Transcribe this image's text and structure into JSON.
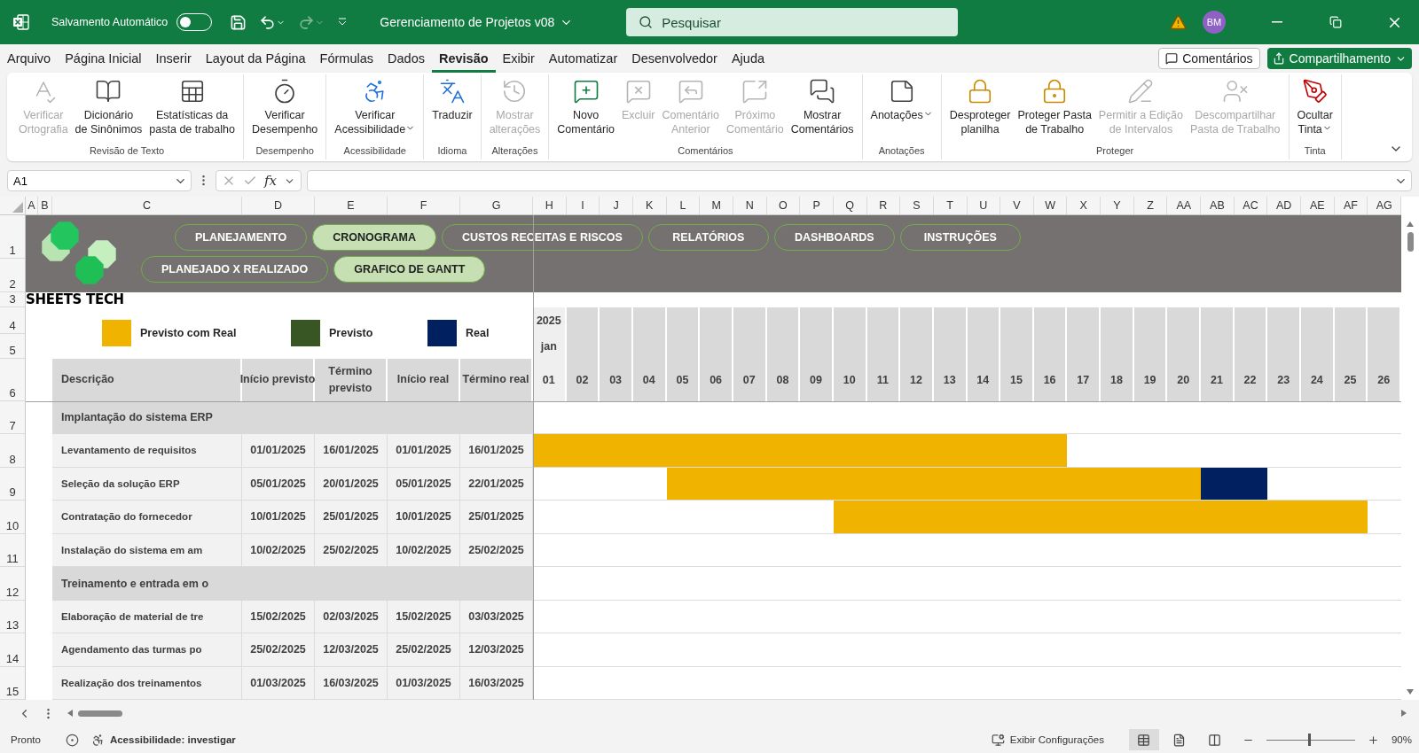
{
  "title_bar": {
    "autosave_label": "Salvamento Automático",
    "autosave_on": false,
    "redo_disabled": true,
    "title": "Gerenciamento de Projetos v08",
    "search": {
      "placeholder": "Pesquisar"
    },
    "avatar": "BM"
  },
  "menu": {
    "tabs": [
      {
        "label": "Arquivo",
        "selected": false
      },
      {
        "label": "Página Inicial",
        "selected": false
      },
      {
        "label": "Inserir",
        "selected": false
      },
      {
        "label": "Layout da Página",
        "selected": false
      },
      {
        "label": "Fórmulas",
        "selected": false
      },
      {
        "label": "Dados",
        "selected": false
      },
      {
        "label": "Revisão",
        "selected": true
      },
      {
        "label": "Exibir",
        "selected": false
      },
      {
        "label": "Automatizar",
        "selected": false
      },
      {
        "label": "Desenvolvedor",
        "selected": false
      },
      {
        "label": "Ajuda",
        "selected": false
      }
    ],
    "comments_button": "Comentários",
    "share_button": "Compartilhamento"
  },
  "ribbon": {
    "groups": [
      {
        "label": "Revisão de Texto",
        "buttons": [
          {
            "label": "Verificar\nOrtografia",
            "disabled": true,
            "dropdown": false
          },
          {
            "label": "Dicionário\nde Sinônimos",
            "disabled": false,
            "dropdown": false
          },
          {
            "label": "Estatísticas da\npasta de trabalho",
            "disabled": false,
            "dropdown": false
          }
        ]
      },
      {
        "label": "Desempenho",
        "buttons": [
          {
            "label": "Verificar\nDesempenho",
            "disabled": false,
            "dropdown": false
          }
        ]
      },
      {
        "label": "Acessibilidade",
        "buttons": [
          {
            "label": "Verificar\nAcessibilidade",
            "disabled": false,
            "dropdown": true
          }
        ]
      },
      {
        "label": "Idioma",
        "buttons": [
          {
            "label": "Traduzir",
            "disabled": false,
            "dropdown": false
          }
        ]
      },
      {
        "label": "Alterações",
        "buttons": [
          {
            "label": "Mostrar\nalterações",
            "disabled": true,
            "dropdown": false
          }
        ]
      },
      {
        "label": "Comentários",
        "buttons": [
          {
            "label": "Novo\nComentário",
            "disabled": false,
            "dropdown": false
          },
          {
            "label": "Excluir",
            "disabled": true,
            "dropdown": false
          },
          {
            "label": "Comentário\nAnterior",
            "disabled": true,
            "dropdown": false
          },
          {
            "label": "Próximo\nComentário",
            "disabled": true,
            "dropdown": false
          },
          {
            "label": "Mostrar\nComentários",
            "disabled": false,
            "dropdown": false
          }
        ]
      },
      {
        "label": "Anotações",
        "buttons": [
          {
            "label": "Anotações",
            "disabled": false,
            "dropdown": true
          }
        ]
      },
      {
        "label": "Proteger",
        "buttons": [
          {
            "label": "Desproteger\nplanilha",
            "disabled": false,
            "dropdown": false
          },
          {
            "label": "Proteger Pasta\nde Trabalho",
            "disabled": false,
            "dropdown": false
          },
          {
            "label": "Permitir a Edição\nde Intervalos",
            "disabled": true,
            "dropdown": false
          },
          {
            "label": "Descompartilhar\nPasta de Trabalho",
            "disabled": true,
            "dropdown": false
          }
        ]
      },
      {
        "label": "Tinta",
        "buttons": [
          {
            "label": "Ocultar\nTinta",
            "disabled": false,
            "dropdown": true
          }
        ]
      }
    ]
  },
  "formula_bar": {
    "name_box": "A1",
    "function_label": "fx"
  },
  "sheet": {
    "columns": [
      "A",
      "B",
      "C",
      "D",
      "E",
      "F",
      "G",
      "H",
      "I",
      "J",
      "K",
      "L",
      "M",
      "N",
      "O",
      "P",
      "Q",
      "R",
      "S",
      "T",
      "U",
      "V",
      "W",
      "X",
      "Y",
      "Z",
      "AA",
      "AB",
      "AC",
      "AD",
      "AE",
      "AF",
      "AG"
    ],
    "rows": [
      "1",
      "2",
      "3",
      "4",
      "5",
      "6",
      "7",
      "8",
      "9",
      "10",
      "11",
      "12",
      "13",
      "14",
      "15"
    ],
    "nav": [
      [
        {
          "label": "PLANEJAMENTO",
          "selected": false
        },
        {
          "label": "CRONOGRAMA",
          "selected": true
        },
        {
          "label": "CUSTOS RECEITAS E RISCOS",
          "selected": false
        },
        {
          "label": "RELATÓRIOS",
          "selected": false
        },
        {
          "label": "DASHBOARDS",
          "selected": false
        },
        {
          "label": "INSTRUÇÕES",
          "selected": false
        }
      ],
      [
        {
          "label": "PLANEJADO X REALIZADO",
          "selected": false
        },
        {
          "label": "GRAFICO DE GANTT",
          "selected": true
        }
      ]
    ],
    "brand": "SHEETS TECH",
    "legend": [
      {
        "label": "Previsto com Real",
        "kind": "both",
        "color": "#f0b400"
      },
      {
        "label": "Previsto",
        "kind": "planned",
        "color": "#375623"
      },
      {
        "label": "Real",
        "kind": "real",
        "color": "#002060"
      }
    ],
    "table": {
      "columns": [
        "Descrição",
        "Início previsto",
        "Término\nprevisto",
        "Início real",
        "Término real"
      ],
      "rows": [
        {
          "kind": "group",
          "description": "Implantação do sistema ERP"
        },
        {
          "kind": "task",
          "description": "Levantamento de requisitos",
          "planned_start": "01/01/2025",
          "planned_end": "16/01/2025",
          "real_start": "01/01/2025",
          "real_end": "16/01/2025"
        },
        {
          "kind": "task",
          "description": "Seleção da solução ERP",
          "planned_start": "05/01/2025",
          "planned_end": "20/01/2025",
          "real_start": "05/01/2025",
          "real_end": "22/01/2025"
        },
        {
          "kind": "task",
          "description": "Contratação do fornecedor",
          "planned_start": "10/01/2025",
          "planned_end": "25/01/2025",
          "real_start": "10/01/2025",
          "real_end": "25/01/2025"
        },
        {
          "kind": "task",
          "description": "Instalação do sistema em am",
          "planned_start": "10/02/2025",
          "planned_end": "25/02/2025",
          "real_start": "10/02/2025",
          "real_end": "25/02/2025"
        },
        {
          "kind": "group",
          "description": "Treinamento e entrada em o"
        },
        {
          "kind": "task",
          "description": "Elaboração de material de tre",
          "planned_start": "15/02/2025",
          "planned_end": "02/03/2025",
          "real_start": "15/02/2025",
          "real_end": "03/03/2025"
        },
        {
          "kind": "task",
          "description": "Agendamento das turmas po",
          "planned_start": "25/02/2025",
          "planned_end": "12/03/2025",
          "real_start": "25/02/2025",
          "real_end": "12/03/2025"
        },
        {
          "kind": "task",
          "description": "Realização dos treinamentos",
          "planned_start": "01/03/2025",
          "planned_end": "16/03/2025",
          "real_start": "01/03/2025",
          "real_end": "16/03/2025"
        }
      ]
    },
    "timeline": {
      "year": "2025",
      "month": "jan",
      "days": [
        "01",
        "02",
        "03",
        "04",
        "05",
        "06",
        "07",
        "08",
        "09",
        "10",
        "11",
        "12",
        "13",
        "14",
        "15",
        "16",
        "17",
        "18",
        "19",
        "20",
        "21",
        "22",
        "23",
        "24",
        "25",
        "26"
      ]
    }
  },
  "status_bar": {
    "ready": "Pronto",
    "accessibility": "Acessibilidade: investigar",
    "display_settings": "Exibir Configurações",
    "views": [
      {
        "kind": "normal",
        "selected": true
      },
      {
        "kind": "page-layout",
        "selected": false
      },
      {
        "kind": "page-break",
        "selected": false
      }
    ],
    "zoom": {
      "level": 0.47,
      "reading": "90%"
    }
  }
}
